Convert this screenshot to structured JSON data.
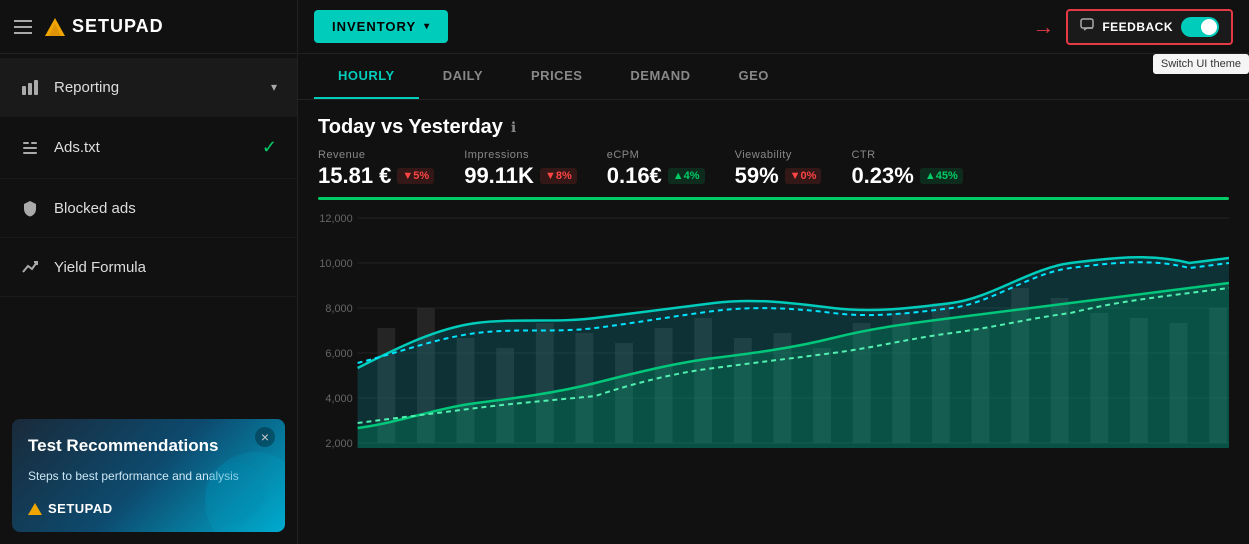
{
  "sidebar": {
    "logo_text": "SETUPAD",
    "nav_items": [
      {
        "id": "reporting",
        "label": "Reporting",
        "icon": "bar-chart",
        "has_chevron": true,
        "has_check": false,
        "active": true
      },
      {
        "id": "ads-txt",
        "label": "Ads.txt",
        "icon": "list",
        "has_chevron": false,
        "has_check": true,
        "active": false
      },
      {
        "id": "blocked-ads",
        "label": "Blocked ads",
        "icon": "shield",
        "has_chevron": false,
        "has_check": false,
        "active": false
      },
      {
        "id": "yield-formula",
        "label": "Yield Formula",
        "icon": "trending",
        "has_chevron": false,
        "has_check": false,
        "active": false
      }
    ]
  },
  "promo": {
    "close_label": "×",
    "title": "Test Recommendations",
    "description": "Steps to best performance and analysis",
    "logo_text": "SETUPAD"
  },
  "topbar": {
    "inventory_label": "INVENTORY",
    "feedback_label": "FEEDBACK",
    "tooltip_text": "Switch UI theme"
  },
  "tabs": [
    {
      "id": "hourly",
      "label": "HOURLY",
      "active": true
    },
    {
      "id": "daily",
      "label": "DAILY",
      "active": false
    },
    {
      "id": "prices",
      "label": "PRICES",
      "active": false
    },
    {
      "id": "demand",
      "label": "DEMAND",
      "active": false
    },
    {
      "id": "geo",
      "label": "GEO",
      "active": false
    }
  ],
  "chart": {
    "title": "Today vs Yesterday",
    "metrics": [
      {
        "label": "Revenue",
        "value": "15.81 €",
        "badge": "▼5%",
        "badge_type": "down"
      },
      {
        "label": "Impressions",
        "value": "99.11K",
        "badge": "▼8%",
        "badge_type": "down"
      },
      {
        "label": "eCPM",
        "value": "0.16€",
        "badge": "▲4%",
        "badge_type": "up"
      },
      {
        "label": "Viewability",
        "value": "59%",
        "badge": "▼0%",
        "badge_type": "down"
      },
      {
        "label": "CTR",
        "value": "0.23%",
        "badge": "▲45%",
        "badge_type": "up"
      }
    ],
    "y_labels": [
      "12,000",
      "10,000",
      "8,000",
      "6,000",
      "4,000",
      "2,000"
    ],
    "colors": {
      "cyan_solid": "#00ccbb",
      "cyan_dashed": "#00e5ff",
      "green_solid": "#00cc66",
      "green_dashed": "#66ffaa",
      "grid": "#222"
    }
  }
}
